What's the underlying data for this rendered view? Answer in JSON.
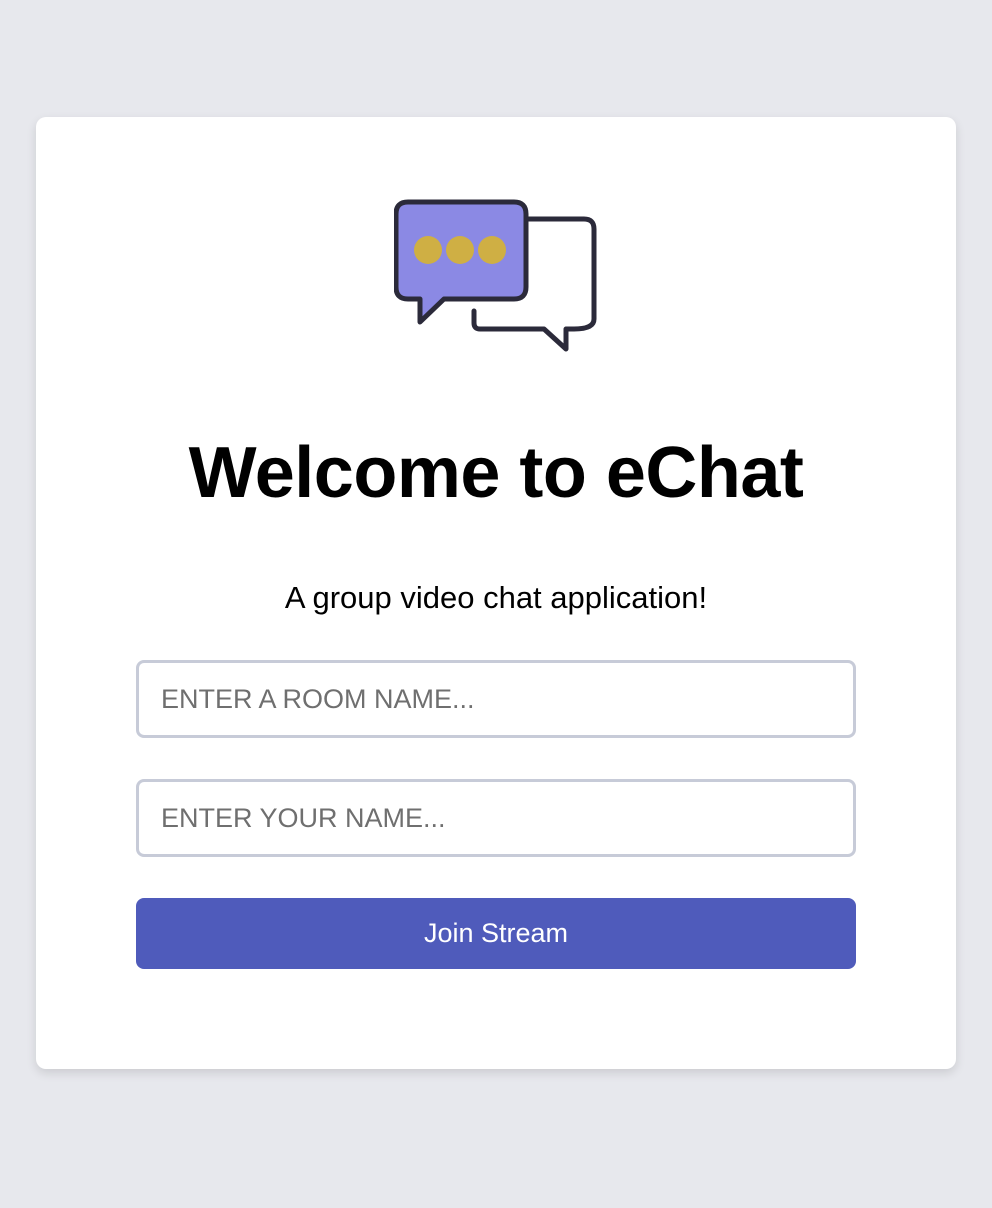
{
  "logo": {
    "icon": "chat-bubbles-icon",
    "colors": {
      "front_bubble": "#8b89e4",
      "dots": "#cfaf44",
      "outline": "#2b2a3a",
      "back_bubble": "#ffffff"
    }
  },
  "title": "Welcome to eChat",
  "subtitle": "A group video chat application!",
  "form": {
    "room_placeholder": "ENTER A ROOM NAME...",
    "room_value": "",
    "name_placeholder": "ENTER YOUR NAME...",
    "name_value": "",
    "join_label": "Join Stream"
  },
  "colors": {
    "background": "#e7e8ed",
    "card": "#ffffff",
    "input_border": "#c7cbd8",
    "button": "#4f5bbb",
    "button_text": "#ffffff"
  }
}
